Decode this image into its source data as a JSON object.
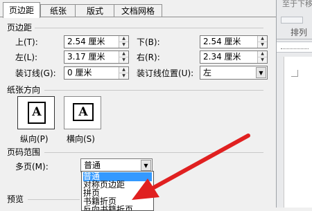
{
  "tabs": [
    {
      "label": "页边距",
      "active": true
    },
    {
      "label": "纸张",
      "active": false
    },
    {
      "label": "版式",
      "active": false
    },
    {
      "label": "文档网格",
      "active": false
    }
  ],
  "margins": {
    "section_title": "页边距",
    "top_label": "上(T):",
    "top_value": "2.54 厘米",
    "bottom_label": "下(B):",
    "bottom_value": "2.54 厘米",
    "left_label": "左(L):",
    "left_value": "3.17 厘米",
    "right_label": "右(R):",
    "right_value": "2.34 厘米",
    "gutter_label": "装订线(G):",
    "gutter_value": "0 厘米",
    "gutter_pos_label": "装订线位置(U):",
    "gutter_pos_value": "左"
  },
  "orientation": {
    "section_title": "纸张方向",
    "portrait_label": "纵向(P)",
    "landscape_label": "横向(S)",
    "icon_letter": "A"
  },
  "pages": {
    "section_title": "页码范围",
    "multiple_label": "多页(M):",
    "selected": "普通",
    "options": [
      "普通",
      "对称页边距",
      "拼页",
      "书籍折页",
      "反向书籍折页"
    ]
  },
  "preview": {
    "section_title": "预览"
  },
  "ribbon": {
    "top_text": "至于下移",
    "arrange_label": "排列"
  },
  "colors": {
    "highlight": "#3399ff",
    "arrow": "#e02020"
  }
}
